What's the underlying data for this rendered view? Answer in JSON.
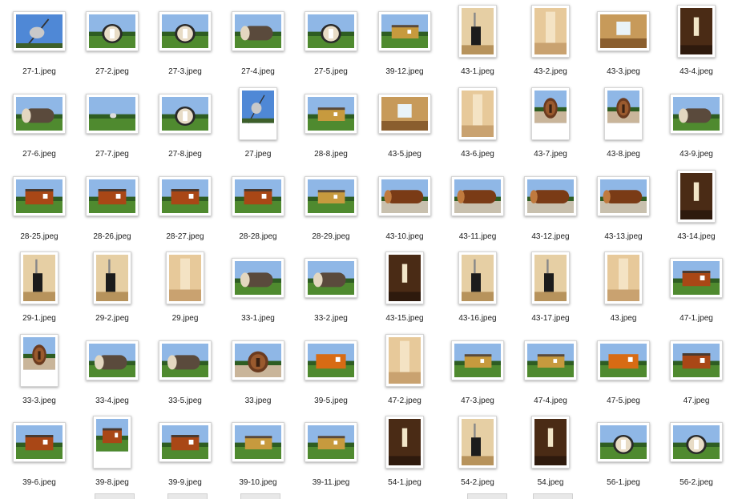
{
  "window": {
    "title": ""
  },
  "files": [
    {
      "name": "27-1.jpeg",
      "scene": "sky-crane",
      "orient": "land"
    },
    {
      "name": "27-2.jpeg",
      "scene": "barrel-front",
      "orient": "land"
    },
    {
      "name": "27-3.jpeg",
      "scene": "barrel-front",
      "orient": "land"
    },
    {
      "name": "27-4.jpeg",
      "scene": "barrel-side",
      "orient": "land"
    },
    {
      "name": "27-5.jpeg",
      "scene": "barrel-front",
      "orient": "land"
    },
    {
      "name": "39-12.jpeg",
      "scene": "cabin-yellow",
      "orient": "land"
    },
    {
      "name": "43-1.jpeg",
      "scene": "interior-stove",
      "orient": "port"
    },
    {
      "name": "43-2.jpeg",
      "scene": "interior-wood",
      "orient": "port"
    },
    {
      "name": "43-3.jpeg",
      "scene": "interior-window",
      "orient": "land"
    },
    {
      "name": "43-4.jpeg",
      "scene": "interior-dark",
      "orient": "port"
    },
    {
      "name": "27-6.jpeg",
      "scene": "barrel-side",
      "orient": "land"
    },
    {
      "name": "27-7.jpeg",
      "scene": "field-far",
      "orient": "land"
    },
    {
      "name": "27-8.jpeg",
      "scene": "barrel-front",
      "orient": "land"
    },
    {
      "name": "27.jpeg",
      "scene": "sky-crane",
      "orient": "port"
    },
    {
      "name": "28-8.jpeg",
      "scene": "cabin-yellow",
      "orient": "land"
    },
    {
      "name": "43-5.jpeg",
      "scene": "interior-window",
      "orient": "land"
    },
    {
      "name": "43-6.jpeg",
      "scene": "interior-wood",
      "orient": "port"
    },
    {
      "name": "43-7.jpeg",
      "scene": "barrel-round",
      "orient": "port"
    },
    {
      "name": "43-8.jpeg",
      "scene": "barrel-round",
      "orient": "port"
    },
    {
      "name": "43-9.jpeg",
      "scene": "barrel-side",
      "orient": "land"
    },
    {
      "name": "28-25.jpeg",
      "scene": "cabin-red",
      "orient": "land"
    },
    {
      "name": "28-26.jpeg",
      "scene": "cabin-red",
      "orient": "land"
    },
    {
      "name": "28-27.jpeg",
      "scene": "cabin-red",
      "orient": "land"
    },
    {
      "name": "28-28.jpeg",
      "scene": "cabin-red",
      "orient": "land"
    },
    {
      "name": "28-29.jpeg",
      "scene": "cabin-yellow",
      "orient": "land"
    },
    {
      "name": "43-10.jpeg",
      "scene": "barrel-long",
      "orient": "land"
    },
    {
      "name": "43-11.jpeg",
      "scene": "barrel-long",
      "orient": "land"
    },
    {
      "name": "43-12.jpeg",
      "scene": "barrel-long",
      "orient": "land"
    },
    {
      "name": "43-13.jpeg",
      "scene": "barrel-long",
      "orient": "land"
    },
    {
      "name": "43-14.jpeg",
      "scene": "interior-dark",
      "orient": "port"
    },
    {
      "name": "29-1.jpeg",
      "scene": "interior-stove",
      "orient": "port"
    },
    {
      "name": "29-2.jpeg",
      "scene": "interior-stove",
      "orient": "port"
    },
    {
      "name": "29.jpeg",
      "scene": "interior-wood",
      "orient": "port"
    },
    {
      "name": "33-1.jpeg",
      "scene": "barrel-side",
      "orient": "land"
    },
    {
      "name": "33-2.jpeg",
      "scene": "barrel-side",
      "orient": "land"
    },
    {
      "name": "43-15.jpeg",
      "scene": "interior-dark",
      "orient": "port"
    },
    {
      "name": "43-16.jpeg",
      "scene": "interior-stove",
      "orient": "port"
    },
    {
      "name": "43-17.jpeg",
      "scene": "interior-stove",
      "orient": "port"
    },
    {
      "name": "43.jpeg",
      "scene": "interior-wood",
      "orient": "port"
    },
    {
      "name": "47-1.jpeg",
      "scene": "cabin-red",
      "orient": "land"
    },
    {
      "name": "33-3.jpeg",
      "scene": "barrel-round",
      "orient": "port"
    },
    {
      "name": "33-4.jpeg",
      "scene": "barrel-side",
      "orient": "land"
    },
    {
      "name": "33-5.jpeg",
      "scene": "barrel-side",
      "orient": "land"
    },
    {
      "name": "33.jpeg",
      "scene": "barrel-round",
      "orient": "land"
    },
    {
      "name": "39-5.jpeg",
      "scene": "cabin-orange",
      "orient": "land"
    },
    {
      "name": "47-2.jpeg",
      "scene": "interior-wood",
      "orient": "port"
    },
    {
      "name": "47-3.jpeg",
      "scene": "cabin-yellow",
      "orient": "land"
    },
    {
      "name": "47-4.jpeg",
      "scene": "cabin-yellow",
      "orient": "land"
    },
    {
      "name": "47-5.jpeg",
      "scene": "cabin-orange",
      "orient": "land"
    },
    {
      "name": "47.jpeg",
      "scene": "cabin-red",
      "orient": "land"
    },
    {
      "name": "39-6.jpeg",
      "scene": "cabin-red",
      "orient": "land"
    },
    {
      "name": "39-8.jpeg",
      "scene": "cabin-red",
      "orient": "port"
    },
    {
      "name": "39-9.jpeg",
      "scene": "cabin-red",
      "orient": "land"
    },
    {
      "name": "39-10.jpeg",
      "scene": "cabin-yellow",
      "orient": "land"
    },
    {
      "name": "39-11.jpeg",
      "scene": "cabin-yellow",
      "orient": "land"
    },
    {
      "name": "54-1.jpeg",
      "scene": "interior-dark",
      "orient": "port"
    },
    {
      "name": "54-2.jpeg",
      "scene": "interior-stove",
      "orient": "port"
    },
    {
      "name": "54.jpeg",
      "scene": "interior-dark",
      "orient": "port"
    },
    {
      "name": "56-1.jpeg",
      "scene": "barrel-front",
      "orient": "land"
    },
    {
      "name": "56-2.jpeg",
      "scene": "barrel-front",
      "orient": "land"
    }
  ]
}
